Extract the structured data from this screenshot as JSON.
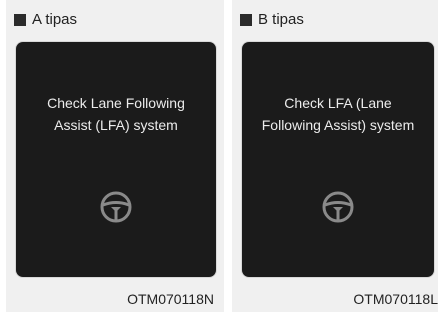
{
  "panels": [
    {
      "heading": "A tipas",
      "message_line1": "Check Lane Following",
      "message_line2": "Assist (LFA) system",
      "code": "OTM070118N"
    },
    {
      "heading": "B tipas",
      "message_line1": "Check LFA (Lane",
      "message_line2": "Following Assist) system",
      "code": "OTM070118L"
    }
  ],
  "icons": {
    "wheel": "steering-wheel-icon",
    "bullet": "square-bullet-icon"
  },
  "colors": {
    "screen_bg": "#1b1b1b",
    "screen_text": "#ececec",
    "icon_color": "#8a8a8a",
    "panel_bg": "#f0f0f0"
  }
}
